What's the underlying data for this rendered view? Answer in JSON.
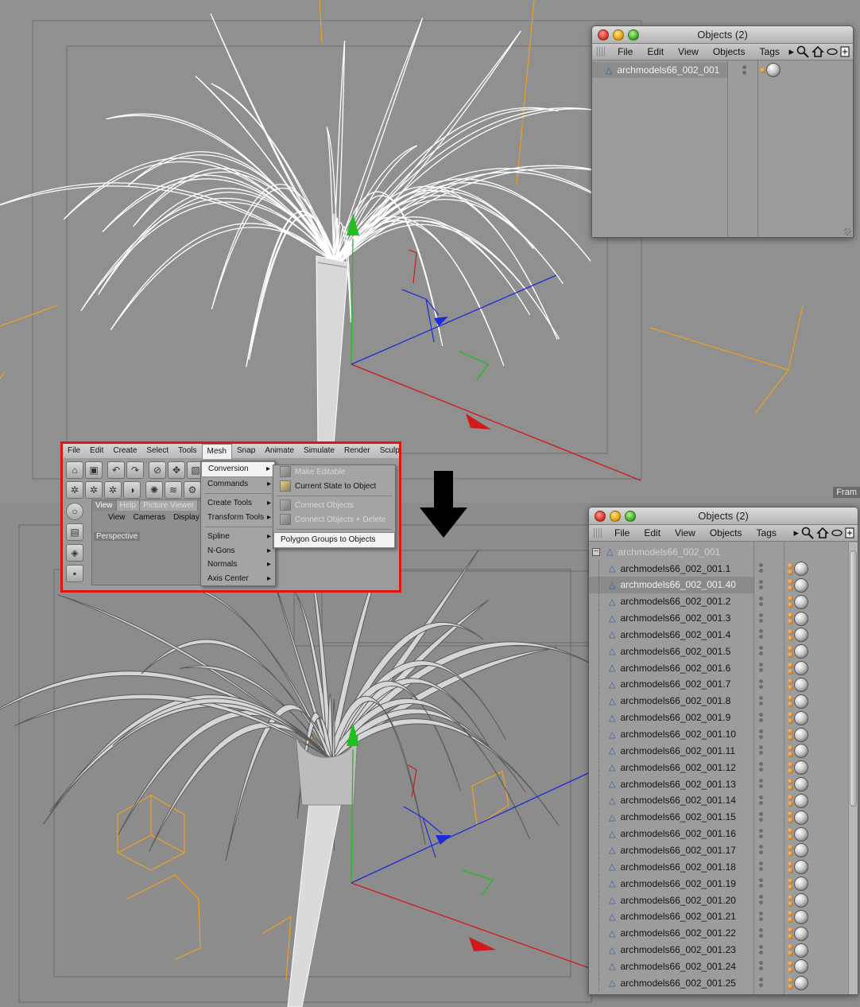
{
  "viewport": {
    "frame_label": "Fram"
  },
  "object_manager_top": {
    "title": "Objects (2)",
    "menu": [
      "File",
      "Edit",
      "View",
      "Objects",
      "Tags"
    ],
    "tools": {
      "arrow": "▸",
      "search_icon": "search-icon",
      "home_icon": "home-icon",
      "link_icon": "link-icon",
      "new_icon": "new-window-icon"
    },
    "objects": [
      {
        "name": "archmodels66_002_001",
        "selected": true
      }
    ]
  },
  "main_menu": {
    "items": [
      "File",
      "Edit",
      "Create",
      "Select",
      "Tools",
      "Mesh",
      "Snap",
      "Animate",
      "Simulate",
      "Render",
      "Sculpt"
    ],
    "active": "Mesh",
    "mesh_dropdown": [
      {
        "label": "Conversion",
        "submenu": true,
        "highlighted": true
      },
      {
        "label": "Commands",
        "submenu": true
      },
      {
        "label": "Create Tools",
        "submenu": true
      },
      {
        "label": "Transform Tools",
        "submenu": true
      },
      {
        "label": "Spline",
        "submenu": true
      },
      {
        "label": "N-Gons",
        "submenu": true
      },
      {
        "label": "Normals",
        "submenu": true
      },
      {
        "label": "Axis Center",
        "submenu": true
      }
    ],
    "conversion_submenu": [
      {
        "label": "Make Editable",
        "enabled": false
      },
      {
        "label": "Current State to Object",
        "enabled": true
      },
      {
        "label": "Connect Objects",
        "enabled": false
      },
      {
        "label": "Connect Objects + Delete",
        "enabled": false
      },
      {
        "label": "Polygon Groups to Objects",
        "enabled": true,
        "highlighted": true
      }
    ],
    "view_tabs": [
      "View",
      "Help",
      "Picture Viewer"
    ],
    "view_submenu": [
      "View",
      "Cameras",
      "Display"
    ],
    "viewport_label": "Perspective"
  },
  "object_manager_bottom": {
    "title": "Objects (2)",
    "menu": [
      "File",
      "Edit",
      "View",
      "Objects",
      "Tags"
    ],
    "parent": {
      "name": "archmodels66_002_001",
      "expanded": true
    },
    "children": [
      {
        "name": "archmodels66_002_001.1",
        "selected": false
      },
      {
        "name": "archmodels66_002_001.40",
        "selected": true
      },
      {
        "name": "archmodels66_002_001.2",
        "selected": false
      },
      {
        "name": "archmodels66_002_001.3",
        "selected": false
      },
      {
        "name": "archmodels66_002_001.4",
        "selected": false
      },
      {
        "name": "archmodels66_002_001.5",
        "selected": false
      },
      {
        "name": "archmodels66_002_001.6",
        "selected": false
      },
      {
        "name": "archmodels66_002_001.7",
        "selected": false
      },
      {
        "name": "archmodels66_002_001.8",
        "selected": false
      },
      {
        "name": "archmodels66_002_001.9",
        "selected": false
      },
      {
        "name": "archmodels66_002_001.10",
        "selected": false
      },
      {
        "name": "archmodels66_002_001.11",
        "selected": false
      },
      {
        "name": "archmodels66_002_001.12",
        "selected": false
      },
      {
        "name": "archmodels66_002_001.13",
        "selected": false
      },
      {
        "name": "archmodels66_002_001.14",
        "selected": false
      },
      {
        "name": "archmodels66_002_001.15",
        "selected": false
      },
      {
        "name": "archmodels66_002_001.16",
        "selected": false
      },
      {
        "name": "archmodels66_002_001.17",
        "selected": false
      },
      {
        "name": "archmodels66_002_001.18",
        "selected": false
      },
      {
        "name": "archmodels66_002_001.19",
        "selected": false
      },
      {
        "name": "archmodels66_002_001.20",
        "selected": false
      },
      {
        "name": "archmodels66_002_001.21",
        "selected": false
      },
      {
        "name": "archmodels66_002_001.22",
        "selected": false
      },
      {
        "name": "archmodels66_002_001.23",
        "selected": false
      },
      {
        "name": "archmodels66_002_001.24",
        "selected": false
      },
      {
        "name": "archmodels66_002_001.25",
        "selected": false
      }
    ]
  },
  "colors": {
    "axis_x": "#d21818",
    "axis_y": "#1fbf1f",
    "axis_z": "#1b2bd8",
    "highlight_border": "#e01414",
    "camera_lines": "#f0a020"
  }
}
